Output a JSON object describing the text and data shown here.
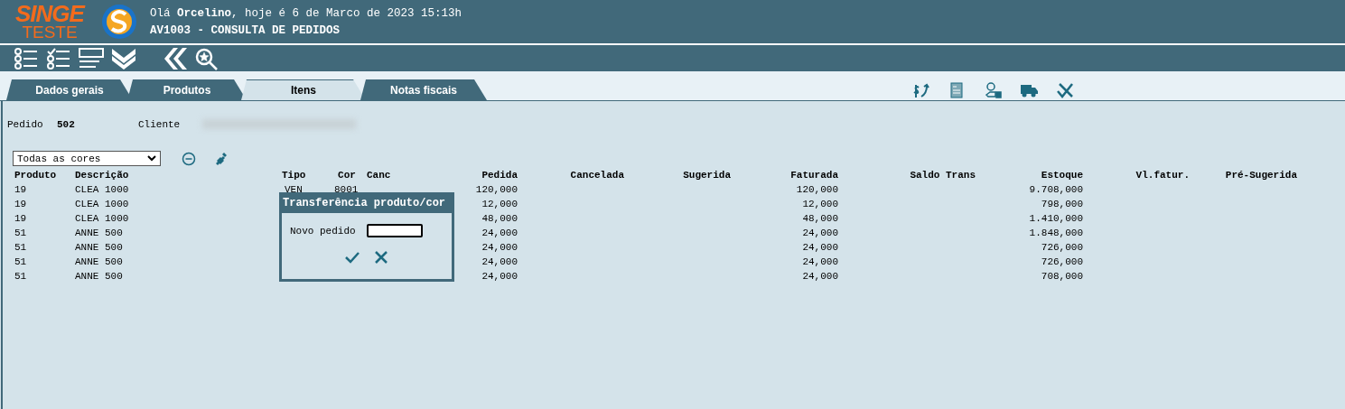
{
  "header": {
    "logo_top": "SINGE",
    "logo_bottom": "TESTE",
    "greeting": "Olá **Orcelino**, hoje é 6 de Marco de 2023 15:13h",
    "title": "AV1003 - CONSULTA DE PEDIDOS"
  },
  "tabs": [
    {
      "label": "Dados gerais",
      "selected": false
    },
    {
      "label": "Produtos",
      "selected": false
    },
    {
      "label": "Itens",
      "selected": true
    },
    {
      "label": "Notas fiscais",
      "selected": false
    }
  ],
  "order": {
    "pedido_label": "Pedido",
    "pedido": "502",
    "cliente_label": "Cliente"
  },
  "color_filter": {
    "value": "Todas as cores"
  },
  "table": {
    "columns": [
      "Produto",
      "Descrição",
      "Tipo",
      "Cor",
      "Canc",
      "Pedida",
      "Cancelada",
      "Sugerida",
      "Faturada",
      "Saldo Trans",
      "Estoque",
      "Vl.fatur.",
      "Pré-Sugerida"
    ],
    "rows": [
      {
        "produto": "19",
        "descricao": "CLEA 1000",
        "tipo": "VEN",
        "cor": "8001",
        "pedida": "120,000",
        "faturada": "120,000",
        "estoque": "9.708,000"
      },
      {
        "produto": "19",
        "descricao": "CLEA 1000",
        "pedida": "12,000",
        "faturada": "12,000",
        "estoque": "798,000"
      },
      {
        "produto": "19",
        "descricao": "CLEA 1000",
        "pedida": "48,000",
        "faturada": "48,000",
        "estoque": "1.410,000"
      },
      {
        "produto": "51",
        "descricao": "ANNE 500",
        "pedida": "24,000",
        "faturada": "24,000",
        "estoque": "1.848,000"
      },
      {
        "produto": "51",
        "descricao": "ANNE 500",
        "pedida": "24,000",
        "faturada": "24,000",
        "estoque": "726,000"
      },
      {
        "produto": "51",
        "descricao": "ANNE 500",
        "pedida": "24,000",
        "faturada": "24,000",
        "estoque": "726,000"
      },
      {
        "produto": "51",
        "descricao": "ANNE 500",
        "pedida": "24,000",
        "faturada": "24,000",
        "estoque": "708,000"
      }
    ]
  },
  "dialog": {
    "title": "Transferência produto/cor",
    "field_label": "Novo pedido"
  }
}
